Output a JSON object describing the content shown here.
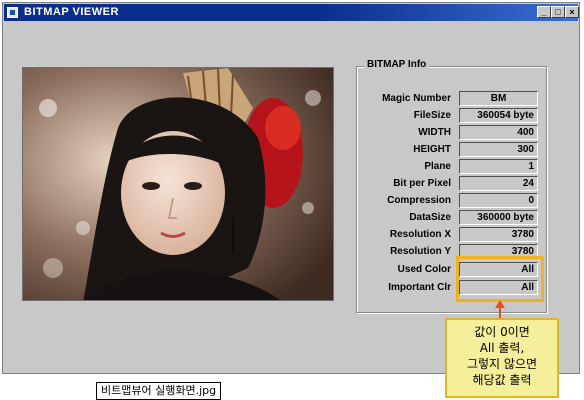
{
  "window": {
    "title": "BITMAP VIEWER",
    "controls": {
      "minimize": "_",
      "maximize": "□",
      "close": "×"
    }
  },
  "info_group": {
    "title": "BITMAP Info",
    "fields": [
      {
        "label": "Magic Number",
        "value": "BM"
      },
      {
        "label": "FileSize",
        "value": "360054 byte"
      },
      {
        "label": "WIDTH",
        "value": "400"
      },
      {
        "label": "HEIGHT",
        "value": "300"
      },
      {
        "label": "Plane",
        "value": "1"
      },
      {
        "label": "Bit per Pixel",
        "value": "24"
      },
      {
        "label": "Compression",
        "value": "0"
      },
      {
        "label": "DataSize",
        "value": "360000 byte"
      },
      {
        "label": "Resolution X",
        "value": "3780"
      },
      {
        "label": "Resolution Y",
        "value": "3780"
      },
      {
        "label": "Used Color",
        "value": "All"
      },
      {
        "label": "Important Clr",
        "value": "All"
      }
    ]
  },
  "annotation": {
    "lines": [
      "값이 0이면",
      "All 출력,",
      "그렇지 않으면",
      "해당값 출력"
    ],
    "highlight_color": "#f0b21e",
    "arrow_color": "#e8501a"
  },
  "caption": "비트맵뷰어 실행화면.jpg"
}
